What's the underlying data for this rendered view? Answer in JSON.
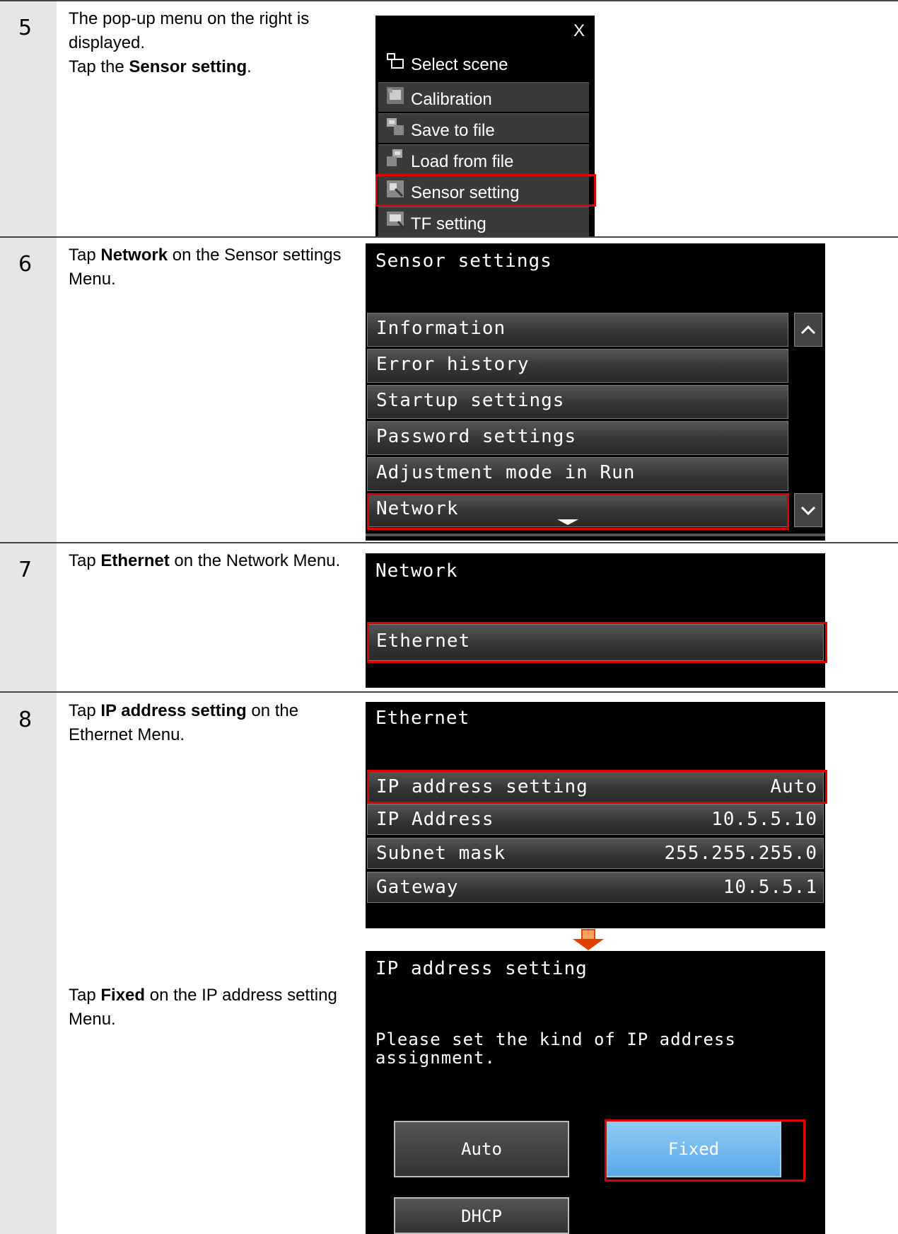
{
  "steps": [
    {
      "number": "5",
      "text_1": "The pop-up menu on the right is displayed.",
      "text_2a": "Tap the ",
      "text_2b": "Sensor setting",
      "text_2c": ".",
      "popup": {
        "close": "X",
        "items": [
          "Select scene",
          "Calibration",
          "Save to file",
          "Load from file",
          "Sensor setting",
          "TF setting"
        ]
      }
    },
    {
      "number": "6",
      "pre": "Tap ",
      "bold": "Network",
      "post": " on the Sensor settings Menu.",
      "screen_title": "Sensor settings",
      "items": [
        "Information",
        "Error history",
        "Startup settings",
        "Password settings",
        "Adjustment mode in Run",
        "Network"
      ]
    },
    {
      "number": "7",
      "pre": "Tap ",
      "bold": "Ethernet",
      "post": " on the Network Menu.",
      "screen_title": "Network",
      "items": [
        "Ethernet"
      ]
    },
    {
      "number": "8",
      "pre": "Tap ",
      "bold": "IP address setting",
      "post": " on the Ethernet Menu.",
      "screen_title": "Ethernet",
      "rows": [
        {
          "label": "IP address setting",
          "value": "Auto"
        },
        {
          "label": "IP Address",
          "value": "10.5.5.10"
        },
        {
          "label": "Subnet mask",
          "value": "255.255.255.0"
        },
        {
          "label": "Gateway",
          "value": "10.5.5.1"
        }
      ],
      "sub": {
        "pre": "Tap ",
        "bold": "Fixed",
        "post": " on the IP address setting Menu.",
        "screen_title": "IP address setting",
        "message": "Please set the kind of IP address assignment.",
        "buttons": [
          "Auto",
          "Fixed",
          "DHCP"
        ]
      }
    }
  ]
}
